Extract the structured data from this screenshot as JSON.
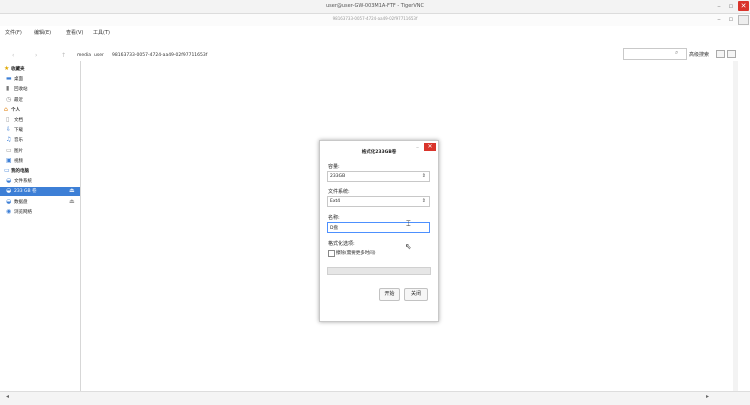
{
  "vnc": {
    "title": "user@user-GW-003M1A-FTF - TigerVNC",
    "min": "–",
    "max": "▫",
    "close": "✕"
  },
  "window": {
    "title": "98163733-0057-4724-aa49-02f97711653f"
  },
  "menu": [
    "文件(F)",
    "编辑(E)",
    "查看(V)",
    "工具(T)"
  ],
  "toolbar": {
    "back": "‹",
    "forward": "›",
    "up": "↑",
    "breadcrumb": [
      "media",
      "user",
      "98163733-0057-4724-aa49-02f97711653f"
    ],
    "advanced_search": "高级搜索"
  },
  "sidebar": [
    {
      "label": "收藏夹",
      "icon": "star-icon",
      "type": "header",
      "color": "#e0a800"
    },
    {
      "label": "桌面",
      "icon": "desktop-icon",
      "type": "item",
      "color": "#3d7fd6"
    },
    {
      "label": "回收站",
      "icon": "trash-icon",
      "type": "item",
      "color": "#777"
    },
    {
      "label": "最近",
      "icon": "clock-icon",
      "type": "item",
      "color": "#888"
    },
    {
      "label": "个人",
      "icon": "home-icon",
      "type": "header",
      "color": "#e07b00"
    },
    {
      "label": "文档",
      "icon": "document-icon",
      "type": "item",
      "color": "#999"
    },
    {
      "label": "下载",
      "icon": "download-icon",
      "type": "item",
      "color": "#3d7fd6"
    },
    {
      "label": "音乐",
      "icon": "music-icon",
      "type": "item",
      "color": "#3d7fd6"
    },
    {
      "label": "图片",
      "icon": "picture-icon",
      "type": "item",
      "color": "#888"
    },
    {
      "label": "视频",
      "icon": "video-icon",
      "type": "item",
      "color": "#3d7fd6"
    },
    {
      "label": "我的电脑",
      "icon": "computer-icon",
      "type": "header",
      "color": "#3d7fd6"
    },
    {
      "label": "文件系统",
      "icon": "drive-icon",
      "type": "item",
      "color": "#3d7fd6"
    },
    {
      "label": "233 GB 卷",
      "icon": "drive-icon",
      "type": "item",
      "selected": true,
      "eject": true,
      "color": "#ffffff"
    },
    {
      "label": "数据盘",
      "icon": "drive-icon",
      "type": "item",
      "eject": true,
      "color": "#3d7fd6"
    },
    {
      "label": "浏览网络",
      "icon": "network-icon",
      "type": "item",
      "color": "#3d7fd6"
    }
  ],
  "dialog": {
    "title": "格式化233GB卷",
    "capacity_label": "容量:",
    "capacity_value": "233GB",
    "fs_label": "文件系统:",
    "fs_value": "Ext4",
    "name_label": "名称:",
    "name_value": "D盘",
    "options_label": "格式化选项:",
    "erase_label": "擦除(需要更多时间)",
    "erase_checked": false,
    "progress": 0,
    "start_label": "开始",
    "close_label": "关闭",
    "min": "–",
    "close_icon": "✕"
  }
}
